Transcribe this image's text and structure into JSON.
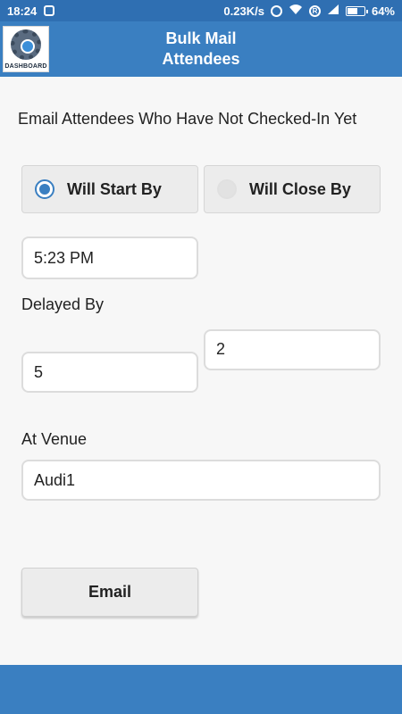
{
  "status_bar": {
    "time": "18:24",
    "speed": "0.23K/s",
    "battery": "64%",
    "battery_level": 0.64,
    "icons": [
      "notification-icon",
      "alarm-icon",
      "wifi-icon",
      "r-badge-icon",
      "signal-icon",
      "battery-icon"
    ]
  },
  "app_bar": {
    "logo_text": "DASHBOARD",
    "title": "Bulk Mail\nAttendees"
  },
  "form": {
    "instruction": "Email Attendees Who Have Not Checked-In Yet",
    "radio_start_label": "Will Start By",
    "radio_close_label": "Will Close By",
    "selected": "Will Start By",
    "time_value": "5:23 PM",
    "delayed_label": "Delayed By",
    "delay_first": "5",
    "delay_second": "2",
    "venue_label": "At Venue",
    "venue_value": "Audi1",
    "email_button": "Email"
  },
  "colors": {
    "primary": "#3a7fc1",
    "status_bar": "#2f6fb2",
    "background": "#f7f7f7"
  }
}
